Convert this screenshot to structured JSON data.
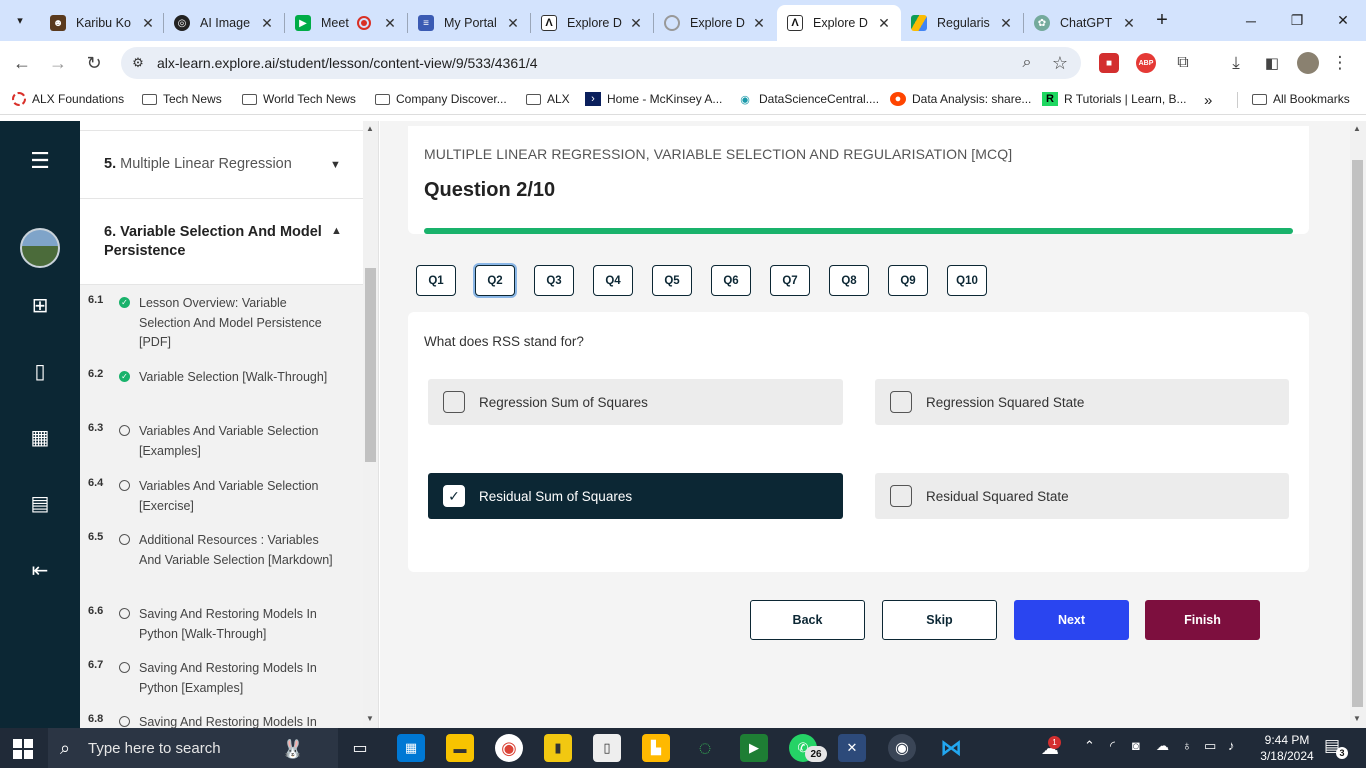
{
  "browser": {
    "tabs": [
      {
        "title": "Karibu Ko",
        "icon": "karibu-favicon"
      },
      {
        "title": "AI Image",
        "icon": "ai-image-favicon"
      },
      {
        "title": "Meet",
        "icon": "meet-favicon"
      },
      {
        "title": "My Portal",
        "icon": "portal-favicon"
      },
      {
        "title": "Explore D",
        "icon": "explore-favicon"
      },
      {
        "title": "Explore D",
        "icon": "loading-favicon"
      },
      {
        "title": "Explore D",
        "icon": "explore-favicon"
      },
      {
        "title": "Regularis",
        "icon": "drive-favicon"
      },
      {
        "title": "ChatGPT",
        "icon": "chatgpt-favicon"
      }
    ],
    "active_tab_index": 6,
    "url": "alx-learn.explore.ai/student/lesson/content-view/9/533/4361/4",
    "bookmarks": [
      "ALX Foundations",
      "Tech News",
      "World Tech News",
      "Company Discover...",
      "ALX",
      "Home - McKinsey A...",
      "DataScienceCentral....",
      "Data Analysis: share...",
      "R Tutorials | Learn, B..."
    ],
    "all_bookmarks": "All Bookmarks"
  },
  "sidebar": {
    "section5": {
      "num": "5.",
      "title": "Multiple Linear Regression"
    },
    "section6": {
      "num": "6.",
      "title": "Variable Selection And Model Persistence"
    },
    "lessons": [
      {
        "num": "6.1",
        "title": "Lesson Overview: Variable Selection And Model Persistence [PDF]",
        "done": true
      },
      {
        "num": "6.2",
        "title": "Variable Selection [Walk-Through]",
        "done": true
      },
      {
        "num": "6.3",
        "title": "Variables And Variable Selection [Examples]",
        "done": false
      },
      {
        "num": "6.4",
        "title": "Variables And Variable Selection [Exercise]",
        "done": false
      },
      {
        "num": "6.5",
        "title": "Additional Resources : Variables And Variable Selection [Markdown]",
        "done": false
      },
      {
        "num": "6.6",
        "title": "Saving And Restoring Models In Python [Walk-Through]",
        "done": false
      },
      {
        "num": "6.7",
        "title": "Saving And Restoring Models In Python [Examples]",
        "done": false
      },
      {
        "num": "6.8",
        "title": "Saving And Restoring Models In",
        "done": false
      }
    ]
  },
  "quiz": {
    "type_label": "MULTIPLE LINEAR REGRESSION, VARIABLE SELECTION AND REGULARISATION [MCQ]",
    "question_label": "Question 2/10",
    "progress": 1.0,
    "question_buttons": [
      "Q1",
      "Q2",
      "Q3",
      "Q4",
      "Q5",
      "Q6",
      "Q7",
      "Q8",
      "Q9",
      "Q10"
    ],
    "current_question": "Q2",
    "question_text": "What does RSS stand for?",
    "options": [
      {
        "label": "Regression Sum of Squares",
        "selected": false
      },
      {
        "label": "Regression Squared State",
        "selected": false
      },
      {
        "label": "Residual Sum of Squares",
        "selected": true
      },
      {
        "label": "Residual Squared State",
        "selected": false
      }
    ],
    "actions": {
      "back": "Back",
      "skip": "Skip",
      "next": "Next",
      "finish": "Finish"
    },
    "colors": {
      "next": "#2a45f0",
      "finish": "#7d0f3e",
      "selected": "#0c2734",
      "progress": "#19b26b"
    }
  },
  "taskbar": {
    "search_placeholder": "Type here to search",
    "whatsapp_badge": "26",
    "weather_badge": "1",
    "time": "9:44 PM",
    "date": "3/18/2024",
    "notifications": "3"
  }
}
